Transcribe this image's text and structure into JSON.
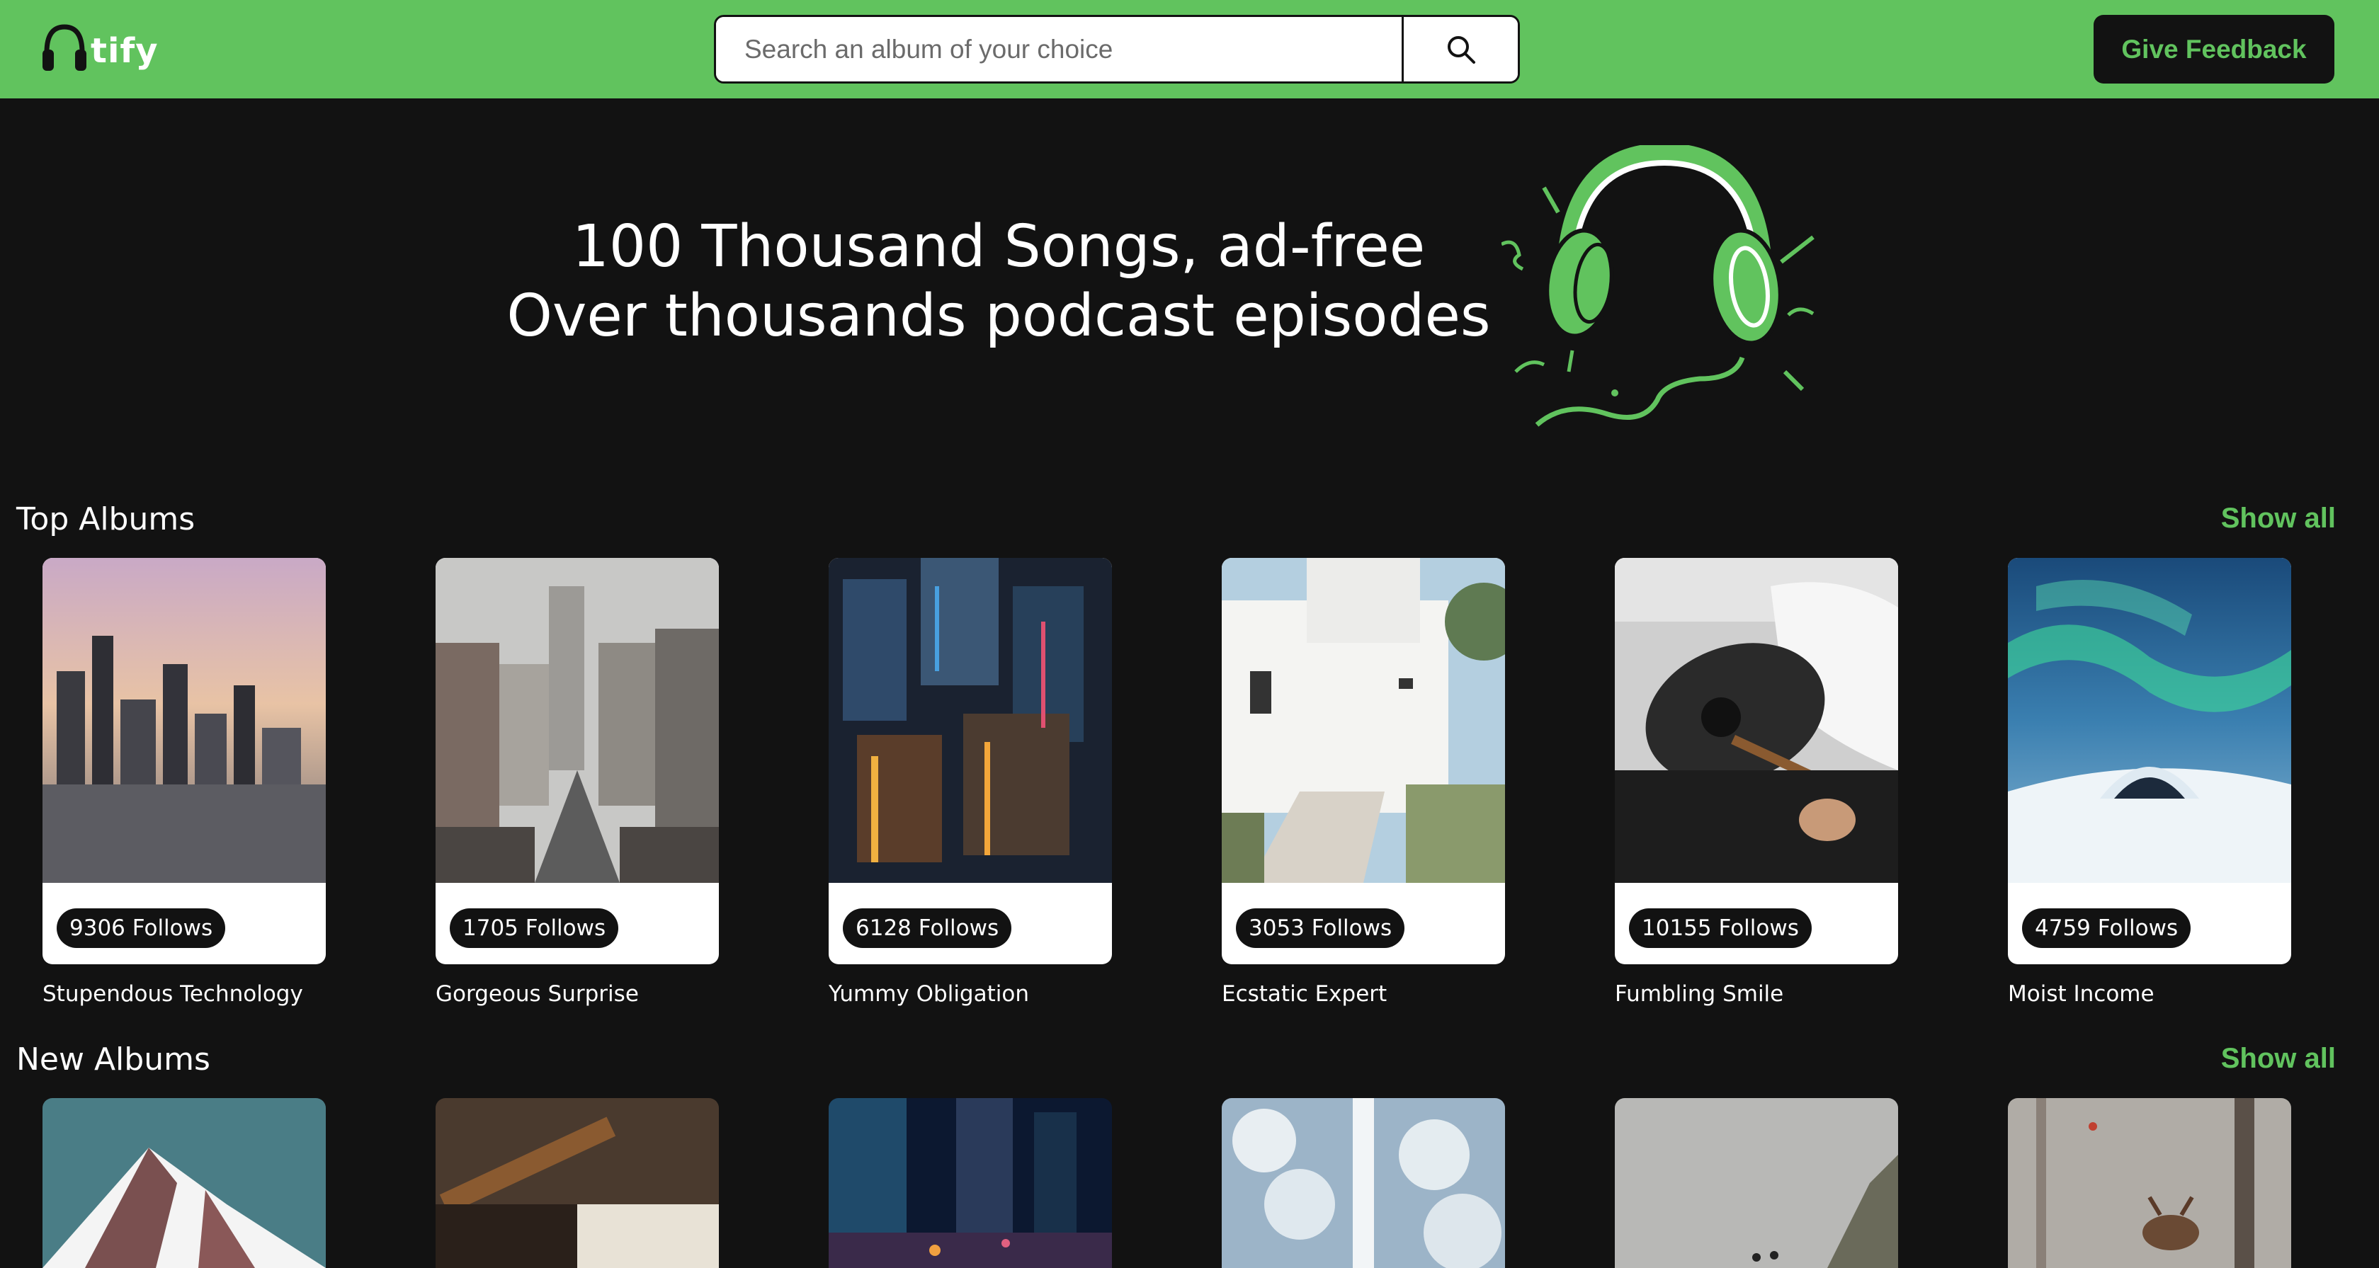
{
  "header": {
    "logo_text": "tify",
    "search_placeholder": "Search an album of your choice",
    "feedback_label": "Give Feedback",
    "icons": {
      "logo": "headphones-icon",
      "search": "search-icon"
    },
    "colors": {
      "brand": "#61c35e",
      "background": "#121212"
    }
  },
  "hero": {
    "line1": "100 Thousand Songs, ad-free",
    "line2": "Over thousands podcast episodes",
    "art": "headphones-illustration"
  },
  "top_albums": {
    "title": "Top Albums",
    "show_all": "Show all",
    "items": [
      {
        "name": "Stupendous Technology",
        "follows": "9306 Follows",
        "scene": "city skyline at dusk"
      },
      {
        "name": "Gorgeous Surprise",
        "follows": "1705 Follows",
        "scene": "city street with cars"
      },
      {
        "name": "Yummy Obligation",
        "follows": "6128 Follows",
        "scene": "aerial city at night"
      },
      {
        "name": "Ecstatic Expert",
        "follows": "3053 Follows",
        "scene": "white house"
      },
      {
        "name": "Fumbling Smile",
        "follows": "10155 Follows",
        "scene": "person playing guitar"
      },
      {
        "name": "Moist Income",
        "follows": "4759 Follows",
        "scene": "aurora over igloo"
      }
    ]
  },
  "new_albums": {
    "title": "New Albums",
    "show_all": "Show all",
    "items": [
      {
        "scene": "snowy mountain peak"
      },
      {
        "scene": "guitar and sheet music"
      },
      {
        "scene": "city towers at night"
      },
      {
        "scene": "snowy forest road"
      },
      {
        "scene": "foggy cliff with birds"
      },
      {
        "scene": "deer in misty forest"
      }
    ]
  }
}
